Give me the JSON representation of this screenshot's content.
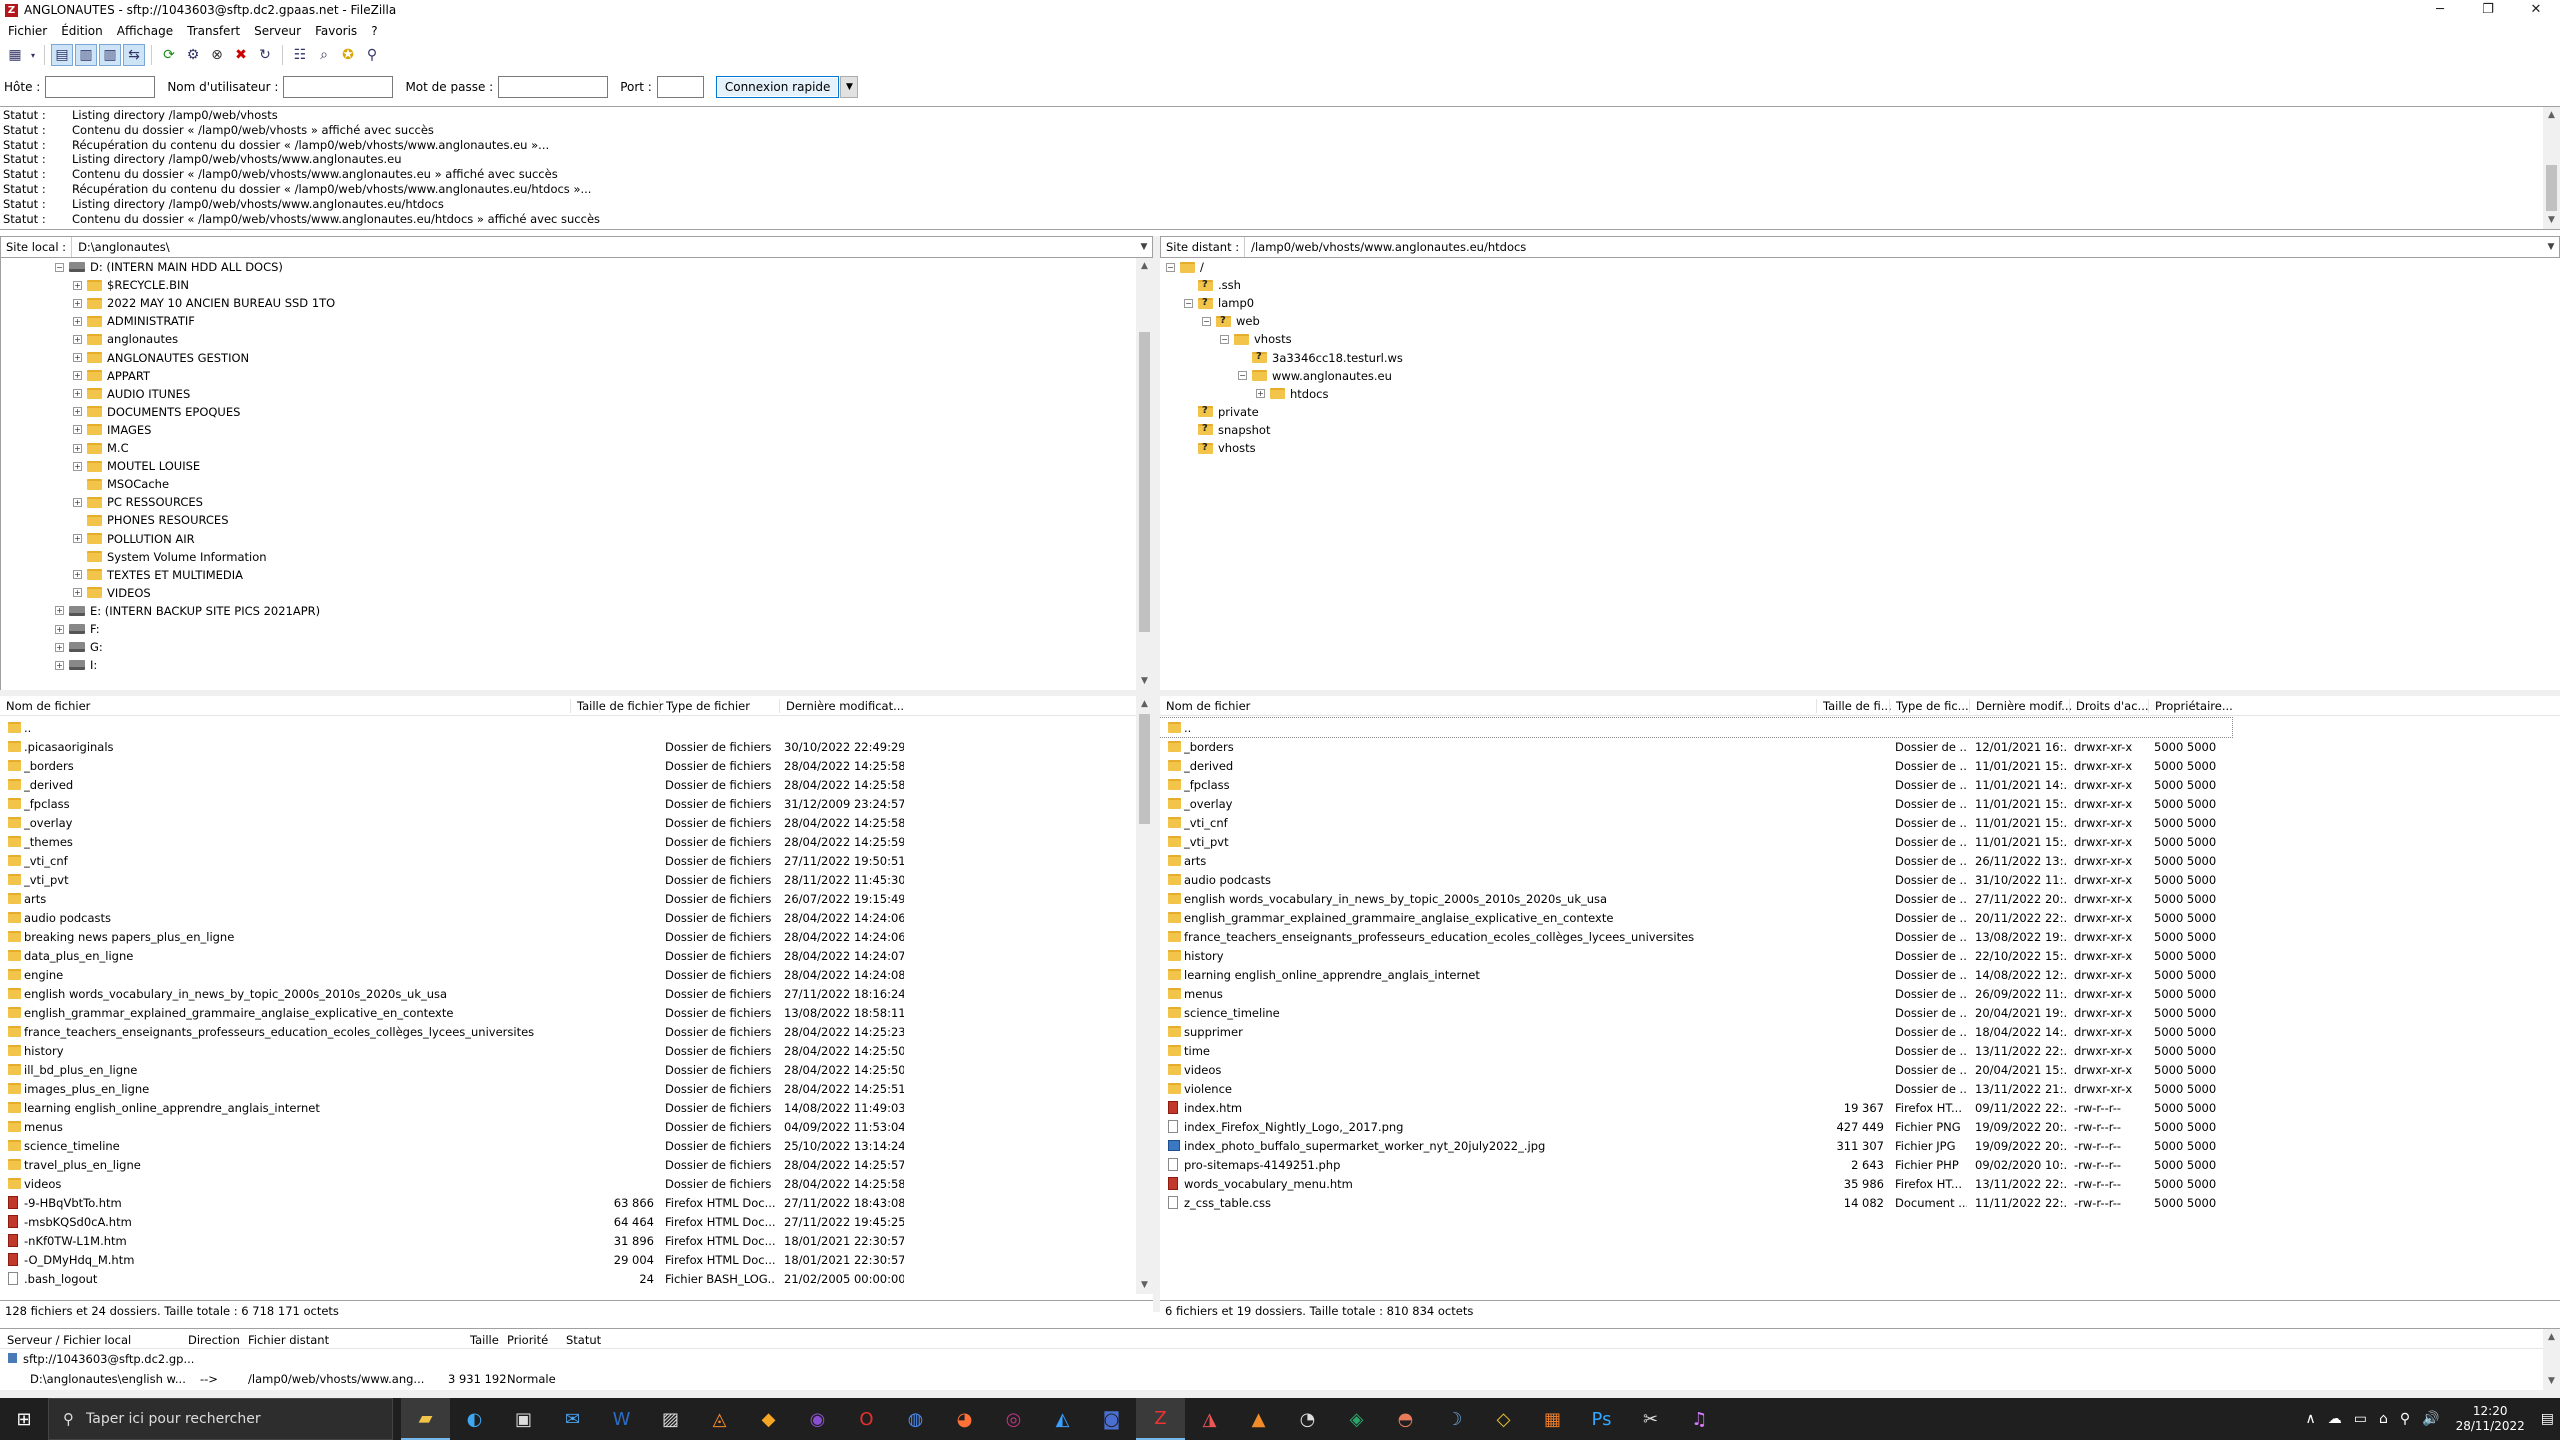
{
  "window": {
    "title": "ANGLONAUTES - sftp://1043603@sftp.dc2.gpaas.net - FileZilla",
    "icon": "filezilla-icon"
  },
  "menu": [
    "Fichier",
    "Édition",
    "Affichage",
    "Transfert",
    "Serveur",
    "Favoris",
    "?"
  ],
  "quickconnect": {
    "host_label": "Hôte :",
    "user_label": "Nom d'utilisateur :",
    "pass_label": "Mot de passe :",
    "port_label": "Port :",
    "host": "",
    "user": "",
    "pass": "",
    "port": "",
    "button": "Connexion rapide"
  },
  "log": [
    {
      "label": "Statut :",
      "msg": "Listing directory /lamp0/web/vhosts"
    },
    {
      "label": "Statut :",
      "msg": "Contenu du dossier « /lamp0/web/vhosts » affiché avec succès"
    },
    {
      "label": "Statut :",
      "msg": "Récupération du contenu du dossier « /lamp0/web/vhosts/www.anglonautes.eu »..."
    },
    {
      "label": "Statut :",
      "msg": "Listing directory /lamp0/web/vhosts/www.anglonautes.eu"
    },
    {
      "label": "Statut :",
      "msg": "Contenu du dossier « /lamp0/web/vhosts/www.anglonautes.eu » affiché avec succès"
    },
    {
      "label": "Statut :",
      "msg": "Récupération du contenu du dossier « /lamp0/web/vhosts/www.anglonautes.eu/htdocs »..."
    },
    {
      "label": "Statut :",
      "msg": "Listing directory /lamp0/web/vhosts/www.anglonautes.eu/htdocs"
    },
    {
      "label": "Statut :",
      "msg": "Contenu du dossier « /lamp0/web/vhosts/www.anglonautes.eu/htdocs » affiché avec succès"
    }
  ],
  "local": {
    "site_label": "Site local :",
    "site_path": "D:\\anglonautes\\",
    "tree": [
      {
        "label": "D: (INTERN MAIN HDD ALL DOCS)",
        "kind": "drive",
        "depth": 2,
        "exp": "-"
      },
      {
        "label": "$RECYCLE.BIN",
        "kind": "folder",
        "depth": 3,
        "exp": "+"
      },
      {
        "label": "2022 MAY 10 ANCIEN BUREAU SSD 1TO",
        "kind": "folder",
        "depth": 3,
        "exp": "+"
      },
      {
        "label": "ADMINISTRATIF",
        "kind": "folder",
        "depth": 3,
        "exp": "+"
      },
      {
        "label": "anglonautes",
        "kind": "folder",
        "depth": 3,
        "exp": "+"
      },
      {
        "label": "ANGLONAUTES GESTION",
        "kind": "folder",
        "depth": 3,
        "exp": "+"
      },
      {
        "label": "APPART",
        "kind": "folder",
        "depth": 3,
        "exp": "+"
      },
      {
        "label": "AUDIO ITUNES",
        "kind": "folder",
        "depth": 3,
        "exp": "+"
      },
      {
        "label": "DOCUMENTS EPOQUES",
        "kind": "folder",
        "depth": 3,
        "exp": "+"
      },
      {
        "label": "IMAGES",
        "kind": "folder",
        "depth": 3,
        "exp": "+"
      },
      {
        "label": "M.C",
        "kind": "folder",
        "depth": 3,
        "exp": "+"
      },
      {
        "label": "MOUTEL LOUISE",
        "kind": "folder",
        "depth": 3,
        "exp": "+"
      },
      {
        "label": "MSOCache",
        "kind": "folder",
        "depth": 3,
        "exp": ""
      },
      {
        "label": "PC RESSOURCES",
        "kind": "folder",
        "depth": 3,
        "exp": "+"
      },
      {
        "label": "PHONES RESOURCES",
        "kind": "folder",
        "depth": 3,
        "exp": ""
      },
      {
        "label": "POLLUTION AIR",
        "kind": "folder",
        "depth": 3,
        "exp": "+"
      },
      {
        "label": "System Volume Information",
        "kind": "folder",
        "depth": 3,
        "exp": ""
      },
      {
        "label": "TEXTES ET MULTIMEDIA",
        "kind": "folder",
        "depth": 3,
        "exp": "+"
      },
      {
        "label": "VIDEOS",
        "kind": "folder",
        "depth": 3,
        "exp": "+"
      },
      {
        "label": "E: (INTERN BACKUP SITE PICS 2021APR)",
        "kind": "drive",
        "depth": 2,
        "exp": "+"
      },
      {
        "label": "F:",
        "kind": "drive",
        "depth": 2,
        "exp": "+"
      },
      {
        "label": "G:",
        "kind": "drive",
        "depth": 2,
        "exp": "+"
      },
      {
        "label": "I:",
        "kind": "drive",
        "depth": 2,
        "exp": "+"
      }
    ],
    "columns": [
      "Nom de fichier",
      "Taille de fichier",
      "Type de fichier",
      "Dernière modificat..."
    ],
    "files": [
      {
        "name": "..",
        "size": "",
        "type": "",
        "date": "",
        "icon": "folder"
      },
      {
        "name": ".picasaoriginals",
        "size": "",
        "type": "Dossier de fichiers",
        "date": "30/10/2022 22:49:29",
        "icon": "folder"
      },
      {
        "name": "_borders",
        "size": "",
        "type": "Dossier de fichiers",
        "date": "28/04/2022 14:25:58",
        "icon": "folder"
      },
      {
        "name": "_derived",
        "size": "",
        "type": "Dossier de fichiers",
        "date": "28/04/2022 14:25:58",
        "icon": "folder"
      },
      {
        "name": "_fpclass",
        "size": "",
        "type": "Dossier de fichiers",
        "date": "31/12/2009 23:24:57",
        "icon": "folder"
      },
      {
        "name": "_overlay",
        "size": "",
        "type": "Dossier de fichiers",
        "date": "28/04/2022 14:25:58",
        "icon": "folder"
      },
      {
        "name": "_themes",
        "size": "",
        "type": "Dossier de fichiers",
        "date": "28/04/2022 14:25:59",
        "icon": "folder"
      },
      {
        "name": "_vti_cnf",
        "size": "",
        "type": "Dossier de fichiers",
        "date": "27/11/2022 19:50:51",
        "icon": "folder"
      },
      {
        "name": "_vti_pvt",
        "size": "",
        "type": "Dossier de fichiers",
        "date": "28/11/2022 11:45:30",
        "icon": "folder"
      },
      {
        "name": "arts",
        "size": "",
        "type": "Dossier de fichiers",
        "date": "26/07/2022 19:15:49",
        "icon": "folder"
      },
      {
        "name": "audio podcasts",
        "size": "",
        "type": "Dossier de fichiers",
        "date": "28/04/2022 14:24:06",
        "icon": "folder"
      },
      {
        "name": "breaking news papers_plus_en_ligne",
        "size": "",
        "type": "Dossier de fichiers",
        "date": "28/04/2022 14:24:06",
        "icon": "folder"
      },
      {
        "name": "data_plus_en_ligne",
        "size": "",
        "type": "Dossier de fichiers",
        "date": "28/04/2022 14:24:07",
        "icon": "folder"
      },
      {
        "name": "engine",
        "size": "",
        "type": "Dossier de fichiers",
        "date": "28/04/2022 14:24:08",
        "icon": "folder"
      },
      {
        "name": "english words_vocabulary_in_news_by_topic_2000s_2010s_2020s_uk_usa",
        "size": "",
        "type": "Dossier de fichiers",
        "date": "27/11/2022 18:16:24",
        "icon": "folder"
      },
      {
        "name": "english_grammar_explained_grammaire_anglaise_explicative_en_contexte",
        "size": "",
        "type": "Dossier de fichiers",
        "date": "13/08/2022 18:58:11",
        "icon": "folder"
      },
      {
        "name": "france_teachers_enseignants_professeurs_education_ecoles_collèges_lycees_universites",
        "size": "",
        "type": "Dossier de fichiers",
        "date": "28/04/2022 14:25:23",
        "icon": "folder"
      },
      {
        "name": "history",
        "size": "",
        "type": "Dossier de fichiers",
        "date": "28/04/2022 14:25:50",
        "icon": "folder"
      },
      {
        "name": "ill_bd_plus_en_ligne",
        "size": "",
        "type": "Dossier de fichiers",
        "date": "28/04/2022 14:25:50",
        "icon": "folder"
      },
      {
        "name": "images_plus_en_ligne",
        "size": "",
        "type": "Dossier de fichiers",
        "date": "28/04/2022 14:25:51",
        "icon": "folder"
      },
      {
        "name": "learning english_online_apprendre_anglais_internet",
        "size": "",
        "type": "Dossier de fichiers",
        "date": "14/08/2022 11:49:03",
        "icon": "folder"
      },
      {
        "name": "menus",
        "size": "",
        "type": "Dossier de fichiers",
        "date": "04/09/2022 11:53:04",
        "icon": "folder"
      },
      {
        "name": "science_timeline",
        "size": "",
        "type": "Dossier de fichiers",
        "date": "25/10/2022 13:14:24",
        "icon": "folder"
      },
      {
        "name": "travel_plus_en_ligne",
        "size": "",
        "type": "Dossier de fichiers",
        "date": "28/04/2022 14:25:57",
        "icon": "folder"
      },
      {
        "name": "videos",
        "size": "",
        "type": "Dossier de fichiers",
        "date": "28/04/2022 14:25:58",
        "icon": "folder"
      },
      {
        "name": "-9-HBqVbtTo.htm",
        "size": "63 866",
        "type": "Firefox HTML Doc...",
        "date": "27/11/2022 18:43:08",
        "icon": "htm"
      },
      {
        "name": "-msbKQSd0cA.htm",
        "size": "64 464",
        "type": "Firefox HTML Doc...",
        "date": "27/11/2022 19:45:25",
        "icon": "htm"
      },
      {
        "name": "-nKf0TW-L1M.htm",
        "size": "31 896",
        "type": "Firefox HTML Doc...",
        "date": "18/01/2021 22:30:57",
        "icon": "htm"
      },
      {
        "name": "-O_DMyHdq_M.htm",
        "size": "29 004",
        "type": "Firefox HTML Doc...",
        "date": "18/01/2021 22:30:57",
        "icon": "htm"
      },
      {
        "name": ".bash_logout",
        "size": "24",
        "type": "Fichier BASH_LOG...",
        "date": "21/02/2005 00:00:00",
        "icon": "file"
      }
    ],
    "status": "128 fichiers et 24 dossiers. Taille totale : 6 718 171 octets"
  },
  "remote": {
    "site_label": "Site distant :",
    "site_path": "/lamp0/web/vhosts/www.anglonautes.eu/htdocs",
    "tree": [
      {
        "label": "/",
        "kind": "folder",
        "depth": 0,
        "exp": "-"
      },
      {
        "label": ".ssh",
        "kind": "qfolder",
        "depth": 1,
        "exp": ""
      },
      {
        "label": "lamp0",
        "kind": "qfolder",
        "depth": 1,
        "exp": "-"
      },
      {
        "label": "web",
        "kind": "qfolder",
        "depth": 2,
        "exp": "-"
      },
      {
        "label": "vhosts",
        "kind": "folder",
        "depth": 3,
        "exp": "-"
      },
      {
        "label": "3a3346cc18.testurl.ws",
        "kind": "qfolder",
        "depth": 4,
        "exp": ""
      },
      {
        "label": "www.anglonautes.eu",
        "kind": "folder",
        "depth": 4,
        "exp": "-"
      },
      {
        "label": "htdocs",
        "kind": "folder",
        "depth": 5,
        "exp": "+"
      },
      {
        "label": "private",
        "kind": "qfolder",
        "depth": 1,
        "exp": ""
      },
      {
        "label": "snapshot",
        "kind": "qfolder",
        "depth": 1,
        "exp": ""
      },
      {
        "label": "vhosts",
        "kind": "qfolder",
        "depth": 1,
        "exp": ""
      }
    ],
    "columns": [
      "Nom de fichier",
      "Taille de fi...",
      "Type de fic...",
      "Dernière modif...",
      "Droits d'ac...",
      "Propriétaire..."
    ],
    "files": [
      {
        "name": "..",
        "size": "",
        "type": "",
        "date": "",
        "perm": "",
        "owner": "",
        "icon": "folder"
      },
      {
        "name": "_borders",
        "size": "",
        "type": "Dossier de ...",
        "date": "12/01/2021 16:...",
        "perm": "drwxr-xr-x",
        "owner": "5000 5000",
        "icon": "folder"
      },
      {
        "name": "_derived",
        "size": "",
        "type": "Dossier de ...",
        "date": "11/01/2021 15:...",
        "perm": "drwxr-xr-x",
        "owner": "5000 5000",
        "icon": "folder"
      },
      {
        "name": "_fpclass",
        "size": "",
        "type": "Dossier de ...",
        "date": "11/01/2021 14:...",
        "perm": "drwxr-xr-x",
        "owner": "5000 5000",
        "icon": "folder"
      },
      {
        "name": "_overlay",
        "size": "",
        "type": "Dossier de ...",
        "date": "11/01/2021 15:...",
        "perm": "drwxr-xr-x",
        "owner": "5000 5000",
        "icon": "folder"
      },
      {
        "name": "_vti_cnf",
        "size": "",
        "type": "Dossier de ...",
        "date": "11/01/2021 15:...",
        "perm": "drwxr-xr-x",
        "owner": "5000 5000",
        "icon": "folder"
      },
      {
        "name": "_vti_pvt",
        "size": "",
        "type": "Dossier de ...",
        "date": "11/01/2021 15:...",
        "perm": "drwxr-xr-x",
        "owner": "5000 5000",
        "icon": "folder"
      },
      {
        "name": "arts",
        "size": "",
        "type": "Dossier de ...",
        "date": "26/11/2022 13:...",
        "perm": "drwxr-xr-x",
        "owner": "5000 5000",
        "icon": "folder"
      },
      {
        "name": "audio podcasts",
        "size": "",
        "type": "Dossier de ...",
        "date": "31/10/2022 11:...",
        "perm": "drwxr-xr-x",
        "owner": "5000 5000",
        "icon": "folder"
      },
      {
        "name": "english words_vocabulary_in_news_by_topic_2000s_2010s_2020s_uk_usa",
        "size": "",
        "type": "Dossier de ...",
        "date": "27/11/2022 20:...",
        "perm": "drwxr-xr-x",
        "owner": "5000 5000",
        "icon": "folder"
      },
      {
        "name": "english_grammar_explained_grammaire_anglaise_explicative_en_contexte",
        "size": "",
        "type": "Dossier de ...",
        "date": "20/11/2022 22:...",
        "perm": "drwxr-xr-x",
        "owner": "5000 5000",
        "icon": "folder"
      },
      {
        "name": "france_teachers_enseignants_professeurs_education_ecoles_collèges_lycees_universites",
        "size": "",
        "type": "Dossier de ...",
        "date": "13/08/2022 19:...",
        "perm": "drwxr-xr-x",
        "owner": "5000 5000",
        "icon": "folder"
      },
      {
        "name": "history",
        "size": "",
        "type": "Dossier de ...",
        "date": "22/10/2022 15:...",
        "perm": "drwxr-xr-x",
        "owner": "5000 5000",
        "icon": "folder"
      },
      {
        "name": "learning english_online_apprendre_anglais_internet",
        "size": "",
        "type": "Dossier de ...",
        "date": "14/08/2022 12:...",
        "perm": "drwxr-xr-x",
        "owner": "5000 5000",
        "icon": "folder"
      },
      {
        "name": "menus",
        "size": "",
        "type": "Dossier de ...",
        "date": "26/09/2022 11:...",
        "perm": "drwxr-xr-x",
        "owner": "5000 5000",
        "icon": "folder"
      },
      {
        "name": "science_timeline",
        "size": "",
        "type": "Dossier de ...",
        "date": "20/04/2021 19:...",
        "perm": "drwxr-xr-x",
        "owner": "5000 5000",
        "icon": "folder"
      },
      {
        "name": "supprimer",
        "size": "",
        "type": "Dossier de ...",
        "date": "18/04/2022 14:...",
        "perm": "drwxr-xr-x",
        "owner": "5000 5000",
        "icon": "folder"
      },
      {
        "name": "time",
        "size": "",
        "type": "Dossier de ...",
        "date": "13/11/2022 22:...",
        "perm": "drwxr-xr-x",
        "owner": "5000 5000",
        "icon": "folder"
      },
      {
        "name": "videos",
        "size": "",
        "type": "Dossier de ...",
        "date": "20/04/2021 15:...",
        "perm": "drwxr-xr-x",
        "owner": "5000 5000",
        "icon": "folder"
      },
      {
        "name": "violence",
        "size": "",
        "type": "Dossier de ...",
        "date": "13/11/2022 21:...",
        "perm": "drwxr-xr-x",
        "owner": "5000 5000",
        "icon": "folder"
      },
      {
        "name": "index.htm",
        "size": "19 367",
        "type": "Firefox HT...",
        "date": "09/11/2022 22:...",
        "perm": "-rw-r--r--",
        "owner": "5000 5000",
        "icon": "htm"
      },
      {
        "name": "index_Firefox_Nightly_Logo,_2017.png",
        "size": "427 449",
        "type": "Fichier PNG",
        "date": "19/09/2022 20:...",
        "perm": "-rw-r--r--",
        "owner": "5000 5000",
        "icon": "file"
      },
      {
        "name": "index_photo_buffalo_supermarket_worker_nyt_20july2022_.jpg",
        "size": "311 307",
        "type": "Fichier JPG",
        "date": "19/09/2022 20:...",
        "perm": "-rw-r--r--",
        "owner": "5000 5000",
        "icon": "img"
      },
      {
        "name": "pro-sitemaps-4149251.php",
        "size": "2 643",
        "type": "Fichier PHP",
        "date": "09/02/2020 10:...",
        "perm": "-rw-r--r--",
        "owner": "5000 5000",
        "icon": "file"
      },
      {
        "name": "words_vocabulary_menu.htm",
        "size": "35 986",
        "type": "Firefox HT...",
        "date": "13/11/2022 22:...",
        "perm": "-rw-r--r--",
        "owner": "5000 5000",
        "icon": "htm"
      },
      {
        "name": "z_css_table.css",
        "size": "14 082",
        "type": "Document ...",
        "date": "11/11/2022 22:...",
        "perm": "-rw-r--r--",
        "owner": "5000 5000",
        "icon": "file"
      }
    ],
    "status": "6 fichiers et 19 dossiers. Taille totale : 810 834 octets"
  },
  "queue": {
    "columns": [
      "Serveur / Fichier local",
      "Direction",
      "Fichier distant",
      "Taille",
      "Priorité",
      "Statut"
    ],
    "server": "sftp://1043603@sftp.dc2.gp...",
    "row": {
      "local": "D:\\anglonautes\\english w...",
      "dir": "-->",
      "remote": "/lamp0/web/vhosts/www.ang...",
      "size": "3 931 192",
      "prio": "Normale"
    }
  },
  "taskbar": {
    "search": "Taper ici pour rechercher",
    "time": "12:20",
    "date": "28/11/2022"
  }
}
